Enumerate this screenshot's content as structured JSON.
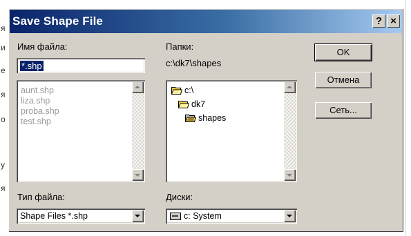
{
  "background_letters": [
    "я",
    "и",
    "е",
    "я",
    "о",
    "у",
    "я"
  ],
  "dialog": {
    "title": "Save Shape File",
    "help_label": "?",
    "close_label": "×"
  },
  "file_name": {
    "label": "Имя файла:",
    "value": "*.shp"
  },
  "files_list": {
    "items": [
      "aunt.shp",
      "liza.shp",
      "proba.shp",
      "test.shp"
    ]
  },
  "folders": {
    "label": "Папки:",
    "current_path": "c:\\dk7\\shapes",
    "items": [
      "c:\\",
      "dk7",
      "shapes"
    ]
  },
  "buttons": {
    "ok": "OK",
    "cancel": "Отмена",
    "network": "Сеть..."
  },
  "file_type": {
    "label": "Тип файла:",
    "value": "Shape Files  *.shp"
  },
  "drives": {
    "label": "Диски:",
    "value": "c: System"
  },
  "colors": {
    "title_bar_start": "#0a246a",
    "title_bar_end": "#a6caf0",
    "dialog_face": "#d4d0c8",
    "selection": "#0a246a",
    "folder_yellow": "#f6d34c"
  }
}
